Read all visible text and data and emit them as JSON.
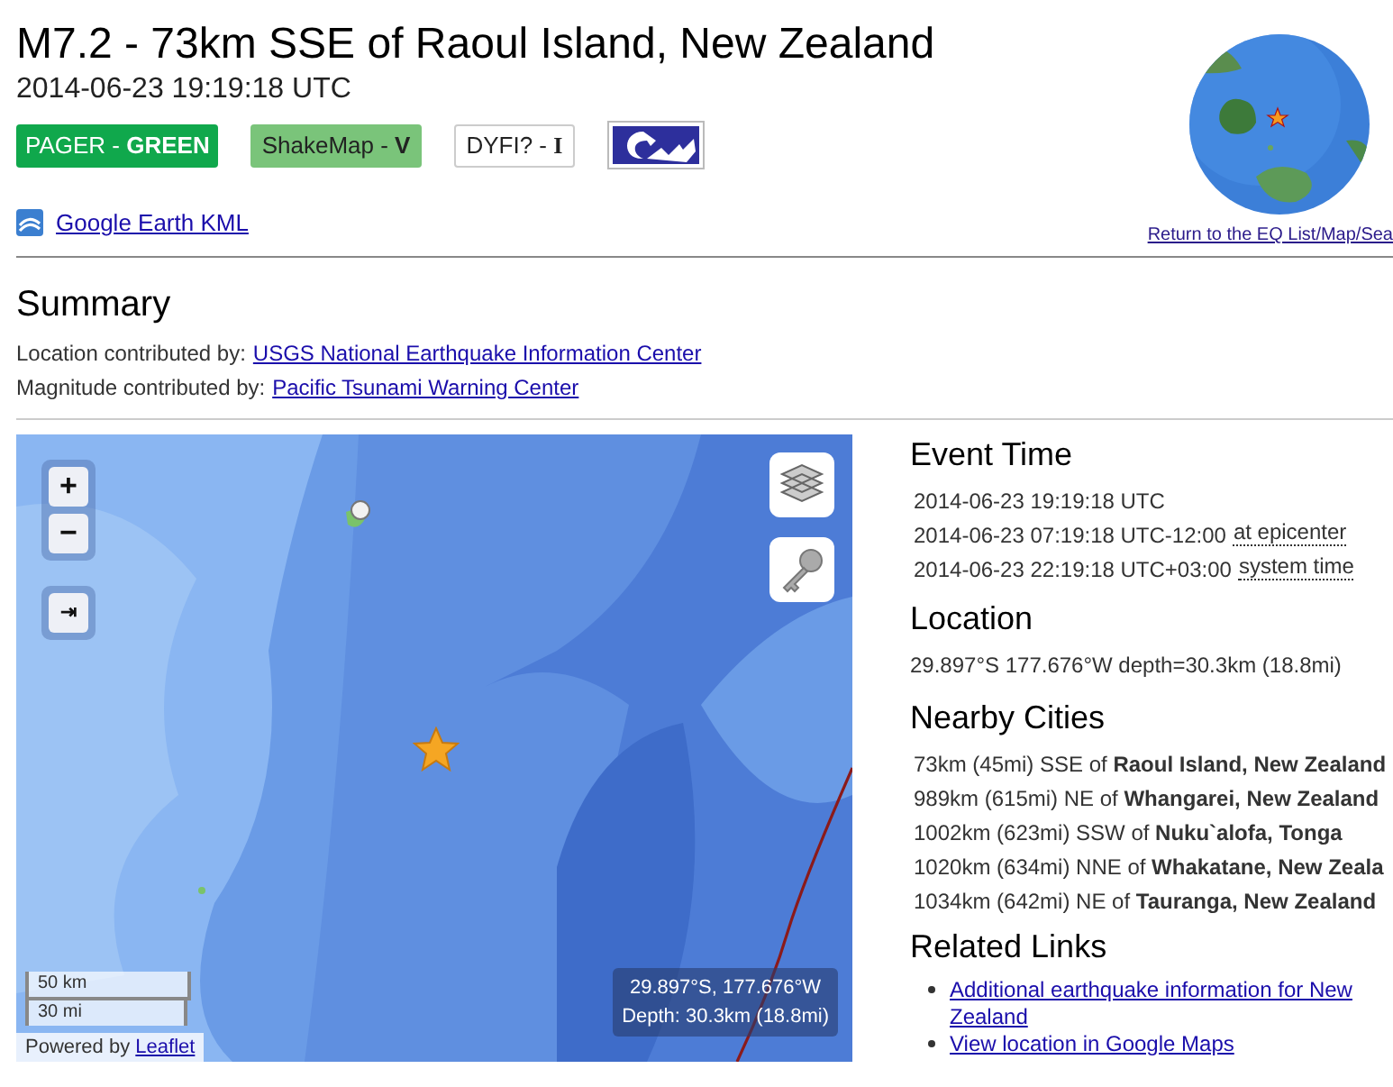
{
  "title": "M7.2 - 73km SSE of Raoul Island, New Zealand",
  "date": "2014-06-23 19:19:18 UTC",
  "badges": [
    {
      "kind": "pager",
      "text": "PAGER - **GREEN**",
      "color": "#10a84c"
    },
    {
      "kind": "shakemap",
      "text": "ShakeMap - **V**",
      "color": "#7ac47a"
    },
    {
      "kind": "dyfi",
      "text": "DYFI? - ",
      "level": "I",
      "color": "#ffffff"
    },
    {
      "kind": "tsunami",
      "color": "#2d2f9c"
    }
  ],
  "kml_link": "Google Earth KML",
  "return_link": "Return to the EQ List/Map/Sea",
  "summary": {
    "heading": "Summary",
    "contributors": [
      {
        "label": "Location contributed by:",
        "link": "USGS National Earthquake Information Center"
      },
      {
        "label": "Magnitude contributed by:",
        "link": "Pacific Tsunami Warning Center"
      }
    ]
  },
  "map": {
    "zoom_in": "+",
    "zoom_out": "−",
    "fullscreen": "⇥",
    "scale": [
      "50 km",
      "30 mi"
    ],
    "attribution": "Powered by",
    "attribution_link": "Leaflet",
    "coords": "29.897°S, 177.676°W",
    "depth": "Depth: 30.3km (18.8mi)"
  },
  "event_time": {
    "heading": "Event Time",
    "times": [
      {
        "time": "2014-06-23 19:19:18 UTC"
      },
      {
        "time": "2014-06-23 07:19:18 UTC-12:00",
        "note": "at epicenter"
      },
      {
        "time": "2014-06-23 22:19:18 UTC+03:00",
        "note": "system time"
      }
    ]
  },
  "location": {
    "heading": "Location",
    "text": "29.897°S 177.676°W depth=30.3km (18.8mi)"
  },
  "nearby": {
    "heading": "Nearby Cities",
    "cities": [
      "73km (45mi) SSE of **Raoul Island, New Zealand**",
      "989km (615mi) NE of **Whangarei, New Zealand**",
      "1002km (623mi) SSW of **Nuku`alofa, Tonga**",
      "1020km (634mi) NNE of **Whakatane, New Zeala**",
      "1034km (642mi) NE of **Tauranga, New Zealand**"
    ]
  },
  "related": {
    "heading": "Related Links",
    "links": [
      "Additional earthquake information for New Zealand",
      "View location in Google Maps"
    ]
  }
}
